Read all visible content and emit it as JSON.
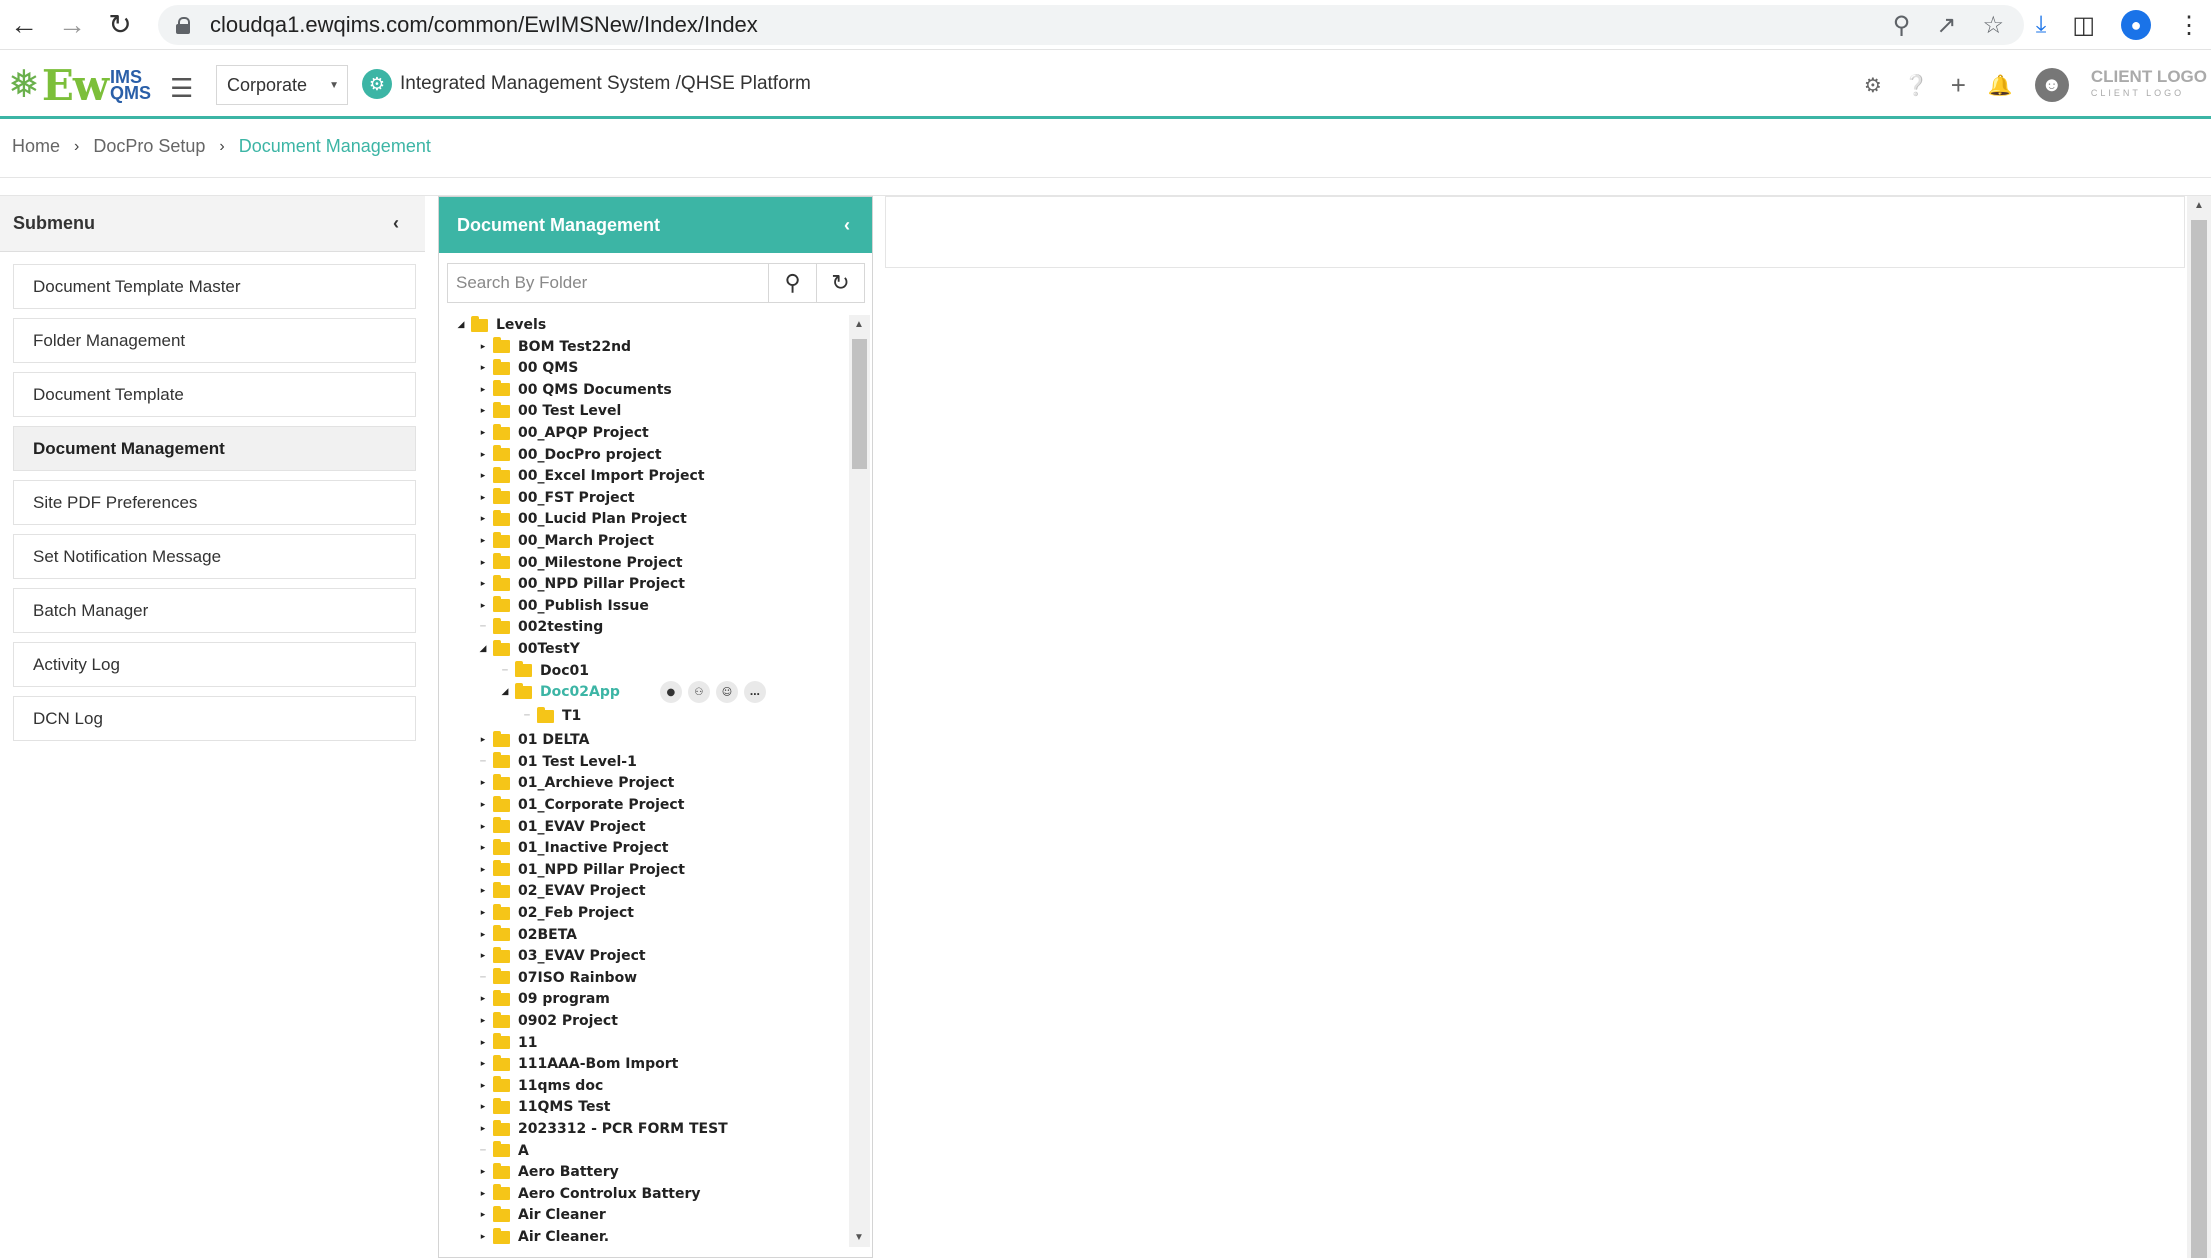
{
  "browser": {
    "url": "cloudqa1.ewqims.com/common/EwIMSNew/Index/Index"
  },
  "header": {
    "logo_ew": "Ew",
    "logo_ims": "IMS",
    "logo_qms": "QMS",
    "company_select": "Corporate",
    "platform_title": "Integrated Management System /QHSE Platform",
    "client_logo": "CLIENT LOGO",
    "client_logo_sub": "CLIENT LOGO"
  },
  "breadcrumb": {
    "items": [
      "Home",
      "DocPro Setup",
      "Document Management"
    ]
  },
  "submenu": {
    "title": "Submenu",
    "items": [
      "Document Template Master",
      "Folder Management",
      "Document Template",
      "Document Management",
      "Site PDF Preferences",
      "Set Notification Message",
      "Batch Manager",
      "Activity Log",
      "DCN Log"
    ],
    "active_index": 3
  },
  "doc_panel": {
    "title": "Document Management",
    "search_placeholder": "Search By Folder",
    "tree": [
      {
        "label": "Levels",
        "level": 0,
        "state": "expanded"
      },
      {
        "label": "BOM Test22nd",
        "level": 1,
        "state": "collapsed"
      },
      {
        "label": "00 QMS",
        "level": 1,
        "state": "collapsed"
      },
      {
        "label": "00 QMS Documents",
        "level": 1,
        "state": "collapsed"
      },
      {
        "label": "00 Test Level",
        "level": 1,
        "state": "collapsed"
      },
      {
        "label": "00_APQP Project",
        "level": 1,
        "state": "collapsed"
      },
      {
        "label": "00_DocPro project",
        "level": 1,
        "state": "collapsed"
      },
      {
        "label": "00_Excel Import Project",
        "level": 1,
        "state": "collapsed"
      },
      {
        "label": "00_FST Project",
        "level": 1,
        "state": "collapsed"
      },
      {
        "label": "00_Lucid Plan Project",
        "level": 1,
        "state": "collapsed"
      },
      {
        "label": "00_March Project",
        "level": 1,
        "state": "collapsed"
      },
      {
        "label": "00_Milestone Project",
        "level": 1,
        "state": "collapsed"
      },
      {
        "label": "00_NPD Pillar Project",
        "level": 1,
        "state": "collapsed"
      },
      {
        "label": "00_Publish Issue",
        "level": 1,
        "state": "collapsed"
      },
      {
        "label": "002testing",
        "level": 1,
        "state": "leaf"
      },
      {
        "label": "00TestY",
        "level": 1,
        "state": "expanded"
      },
      {
        "label": "Doc01",
        "level": 2,
        "state": "leaf"
      },
      {
        "label": "Doc02App",
        "level": 2,
        "state": "expanded",
        "selected": true
      },
      {
        "label": "T1",
        "level": 3,
        "state": "leaf"
      },
      {
        "label": "01 DELTA",
        "level": 1,
        "state": "collapsed"
      },
      {
        "label": "01 Test Level-1",
        "level": 1,
        "state": "leaf"
      },
      {
        "label": "01_Archieve Project",
        "level": 1,
        "state": "collapsed"
      },
      {
        "label": "01_Corporate Project",
        "level": 1,
        "state": "collapsed"
      },
      {
        "label": "01_EVAV Project",
        "level": 1,
        "state": "collapsed"
      },
      {
        "label": "01_Inactive Project",
        "level": 1,
        "state": "collapsed"
      },
      {
        "label": "01_NPD Pillar Project",
        "level": 1,
        "state": "collapsed"
      },
      {
        "label": "02_EVAV Project",
        "level": 1,
        "state": "collapsed"
      },
      {
        "label": "02_Feb Project",
        "level": 1,
        "state": "collapsed"
      },
      {
        "label": "02BETA",
        "level": 1,
        "state": "collapsed"
      },
      {
        "label": "03_EVAV Project",
        "level": 1,
        "state": "collapsed"
      },
      {
        "label": "07ISO Rainbow",
        "level": 1,
        "state": "leaf"
      },
      {
        "label": "09 program",
        "level": 1,
        "state": "collapsed"
      },
      {
        "label": "0902 Project",
        "level": 1,
        "state": "collapsed"
      },
      {
        "label": "11",
        "level": 1,
        "state": "collapsed"
      },
      {
        "label": "111AAA-Bom Import",
        "level": 1,
        "state": "collapsed"
      },
      {
        "label": "11qms doc",
        "level": 1,
        "state": "collapsed"
      },
      {
        "label": "11QMS Test",
        "level": 1,
        "state": "collapsed"
      },
      {
        "label": "2023312 - PCR FORM TEST",
        "level": 1,
        "state": "collapsed"
      },
      {
        "label": "A",
        "level": 1,
        "state": "leaf"
      },
      {
        "label": "Aero Battery",
        "level": 1,
        "state": "collapsed"
      },
      {
        "label": "Aero Controlux Battery",
        "level": 1,
        "state": "collapsed"
      },
      {
        "label": "Air Cleaner",
        "level": 1,
        "state": "collapsed"
      },
      {
        "label": "Air Cleaner.",
        "level": 1,
        "state": "collapsed"
      }
    ]
  },
  "colors": {
    "accent": "#3cb5a5",
    "folder": "#f5c518"
  }
}
